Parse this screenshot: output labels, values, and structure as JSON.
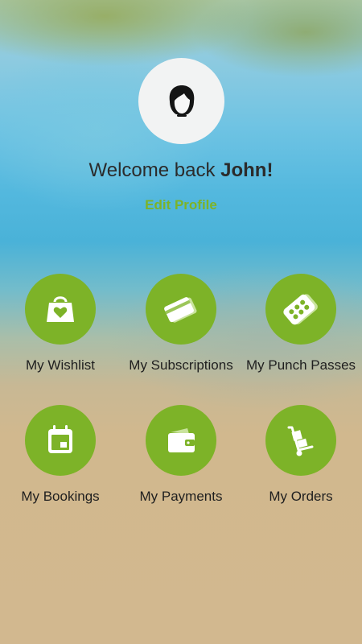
{
  "profile": {
    "welcome_prefix": "Welcome back ",
    "user_name": "John!",
    "edit_profile_label": "Edit Profile",
    "avatar_icon": "user-avatar-icon"
  },
  "menu": {
    "items": [
      {
        "label": "My Wishlist",
        "icon": "shopping-bag-heart-icon"
      },
      {
        "label": "My Subscriptions",
        "icon": "cards-icon"
      },
      {
        "label": "My Punch Passes",
        "icon": "punch-pass-icon"
      },
      {
        "label": "My Bookings",
        "icon": "calendar-icon"
      },
      {
        "label": "My Payments",
        "icon": "wallet-icon"
      },
      {
        "label": "My Orders",
        "icon": "hand-truck-icon"
      }
    ]
  },
  "colors": {
    "accent": "#7db328",
    "avatar_bg": "#f2f3f3",
    "text": "#2b2b2b"
  }
}
